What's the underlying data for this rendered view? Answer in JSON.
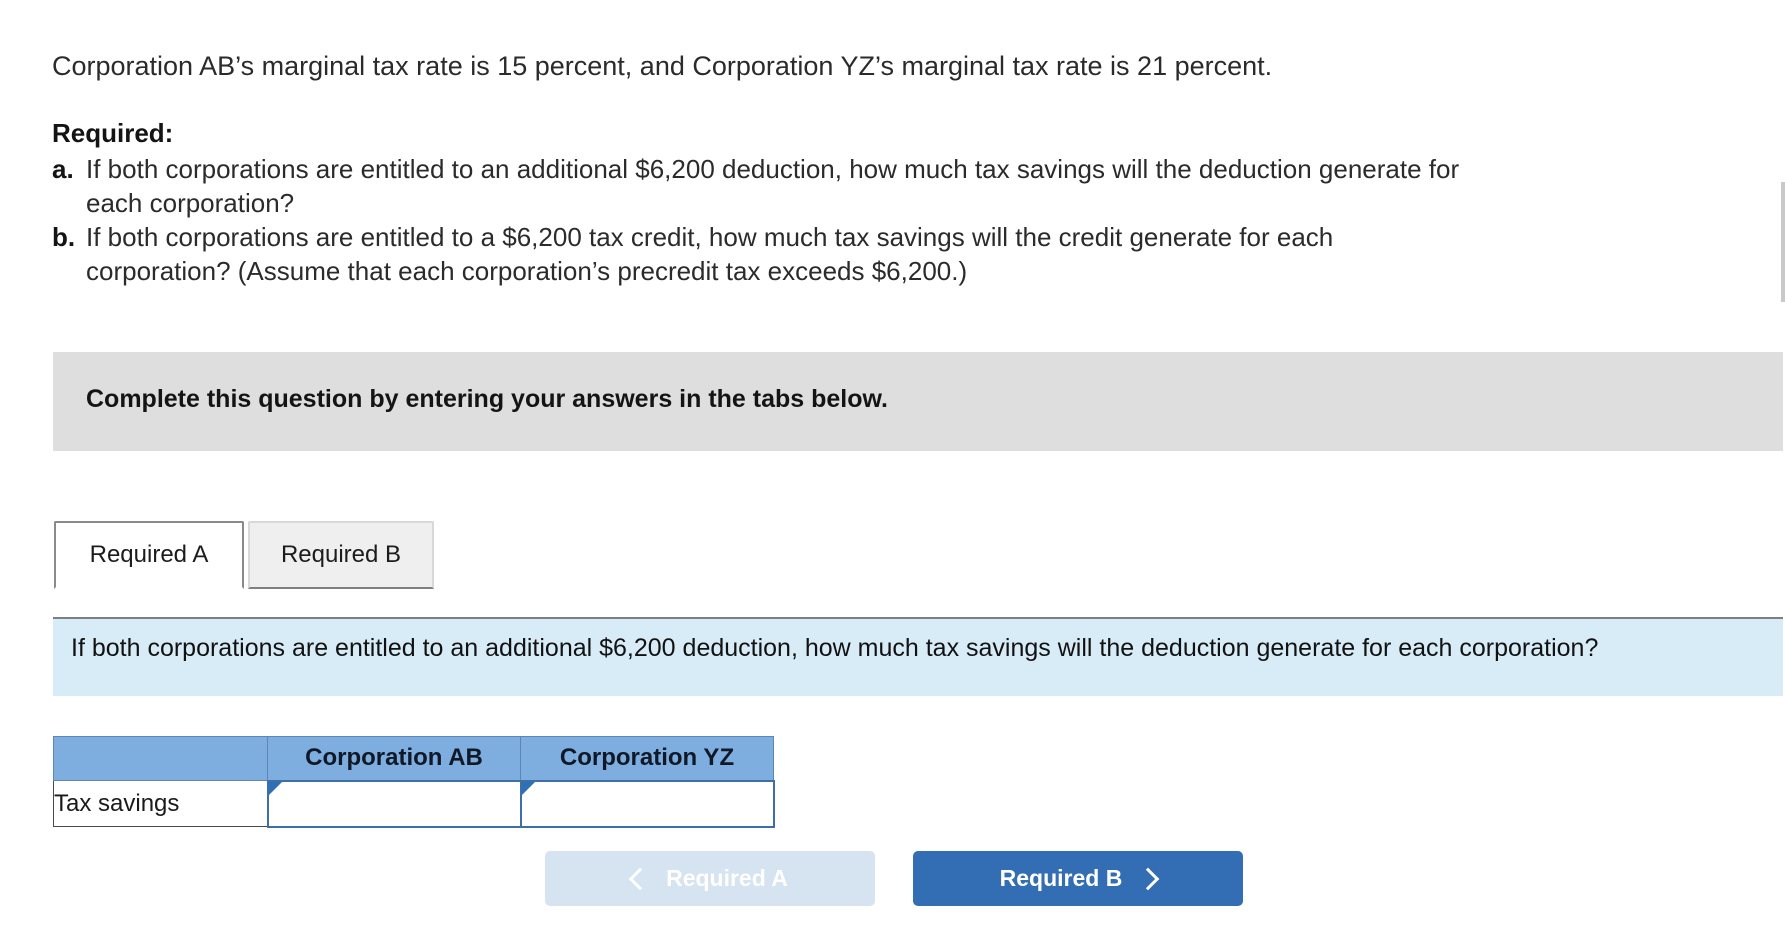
{
  "intro": {
    "text": "Corporation AB’s marginal tax rate is 15 percent, and Corporation YZ’s marginal tax rate is 21 percent."
  },
  "required": {
    "heading": "Required:",
    "items": [
      {
        "marker": "a.",
        "line1": "If both corporations are entitled to an additional $6,200 deduction, how much tax savings will the deduction generate for",
        "line2": "each corporation?"
      },
      {
        "marker": "b.",
        "line1": "If both corporations are entitled to a $6,200 tax credit, how much tax savings will the credit generate for each",
        "line2": "corporation? (Assume that each corporation’s precredit tax exceeds $6,200.)"
      }
    ]
  },
  "instruction_banner": {
    "text": "Complete this question by entering your answers in the tabs below."
  },
  "tabs": [
    {
      "label": "Required A",
      "active": true
    },
    {
      "label": "Required B",
      "active": false
    }
  ],
  "question_panel": {
    "text": "If both corporations are entitled to an additional $6,200 deduction, how much tax savings will the deduction generate for each corporation?"
  },
  "answer_table": {
    "corner_header": "",
    "columns": [
      "Corporation AB",
      "Corporation YZ"
    ],
    "rows": [
      {
        "label": "Tax savings",
        "values": [
          "",
          ""
        ]
      }
    ]
  },
  "footer_nav": {
    "prev_label": "Required A",
    "next_label": "Required B"
  },
  "colors": {
    "banner_gray": "#dedede",
    "panel_blue": "#d8ecf8",
    "table_header_blue": "#7eaedf",
    "button_blue": "#336eb4",
    "button_disabled_blue": "#d6e3f0",
    "input_border_blue": "#3f6fa8"
  }
}
